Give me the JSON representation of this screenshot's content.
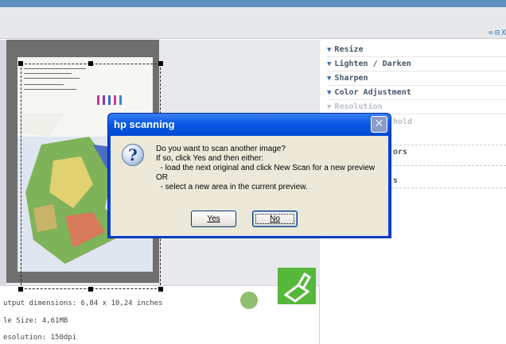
{
  "toolbar": {
    "view_icons": [
      "=",
      "⊟",
      "X"
    ]
  },
  "left": {
    "info": {
      "dimensions": "utput dimensions: 6,84 x 10,24 inches",
      "file_size": "le Size: 4,61MB",
      "resolution": "esolution:  150dpi"
    }
  },
  "panel": {
    "items": [
      {
        "label": "Resize"
      },
      {
        "label": "Lighten / Darken"
      },
      {
        "label": "Sharpen"
      },
      {
        "label": "Color Adjustment"
      },
      {
        "label": "Resolution"
      },
      {
        "label": "hold"
      },
      {
        "label": "ors"
      },
      {
        "label": "s"
      }
    ]
  },
  "dialog": {
    "title": "hp scanning",
    "close_glyph": "✕",
    "icon_glyph": "?",
    "message": [
      "Do you want to scan another image?",
      "If so, click Yes and then either:",
      "  - load the next original and click New Scan for a new preview",
      "OR",
      "  - select a new area in the current preview."
    ],
    "yes_label": "Yes",
    "no_label": "No"
  },
  "colors": {
    "top_bar": "#5f8fbf",
    "panel_text": "#46556a",
    "xp_title_blue": "#0a59e5",
    "dialog_body": "#ece9d8",
    "scan_icon_green": "#55b83a"
  },
  "icons": {
    "collapse_triangle": "▼",
    "scan": "scanner-icon"
  }
}
